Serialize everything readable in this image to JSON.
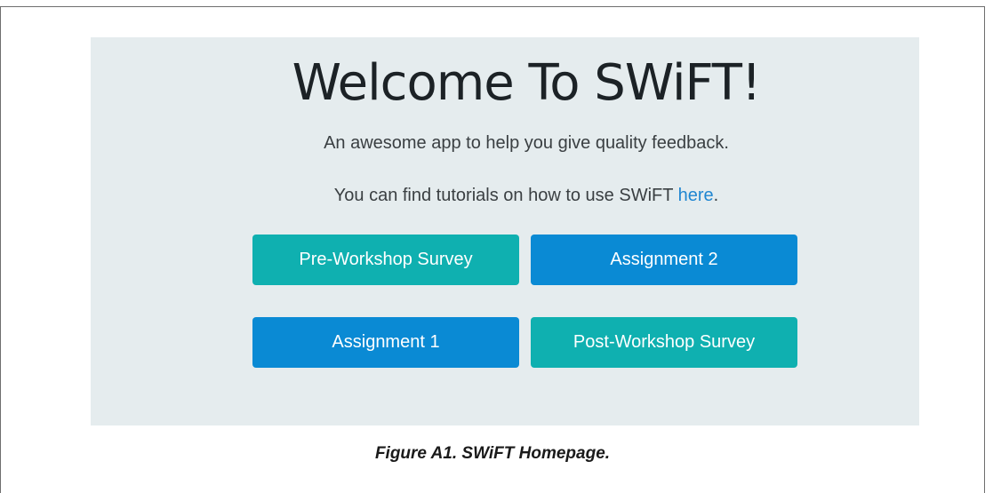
{
  "jumbotron": {
    "title": "Welcome To SWiFT!",
    "subtitle": "An awesome app to help you give quality feedback.",
    "tutorial_prefix": "You can find tutorials on how to use SWiFT ",
    "tutorial_link": "here",
    "tutorial_suffix": "."
  },
  "buttons": {
    "pre_workshop": "Pre-Workshop Survey",
    "assignment_2": "Assignment 2",
    "assignment_1": "Assignment 1",
    "post_workshop": "Post-Workshop Survey"
  },
  "caption": "Figure A1. SWiFT Homepage.",
  "colors": {
    "jumbotron_bg": "#e5ecee",
    "teal_button": "#0fb0b0",
    "blue_button": "#0a8ad4",
    "link": "#1f86d1"
  }
}
